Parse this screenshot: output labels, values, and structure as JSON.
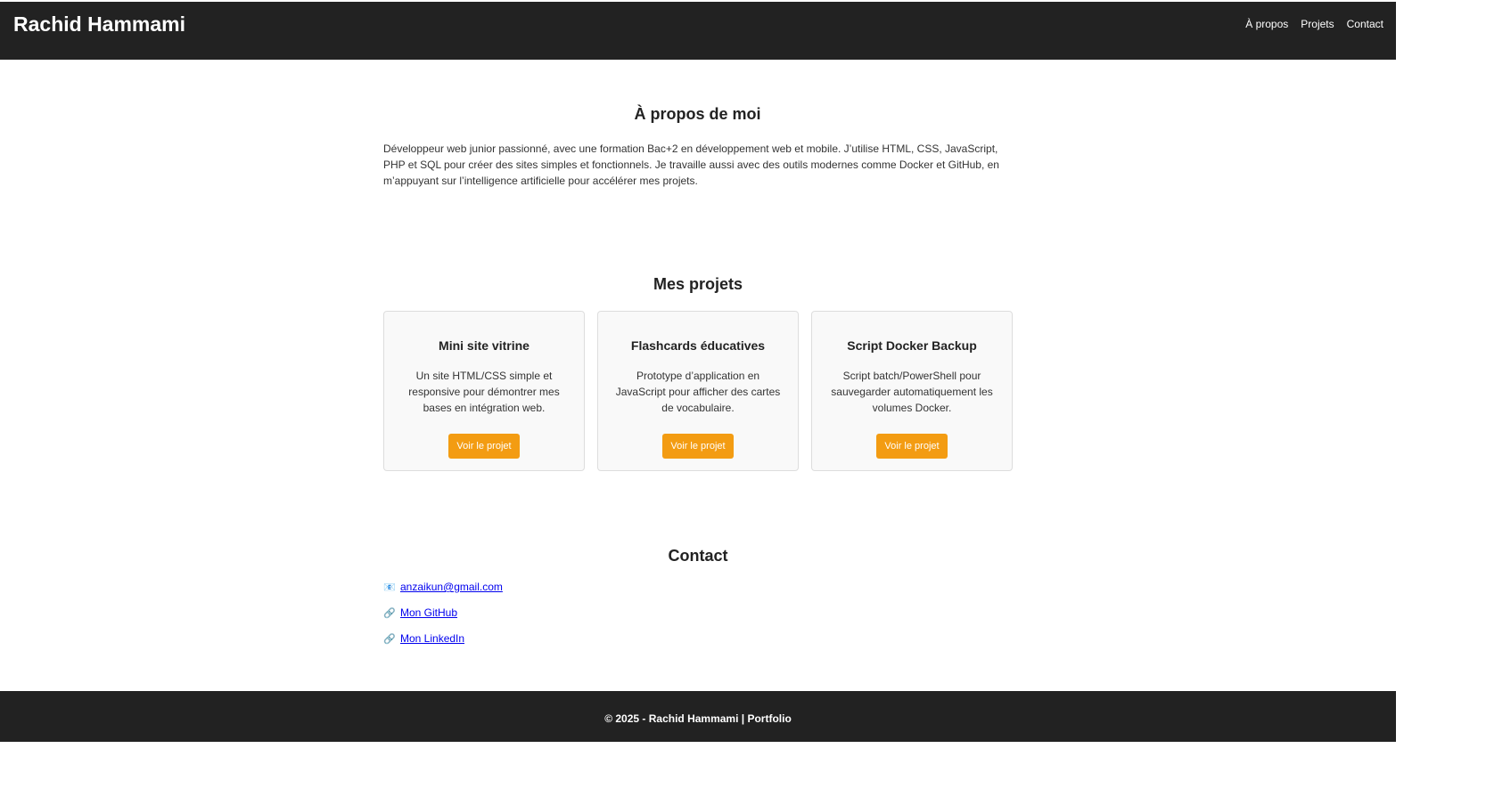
{
  "header": {
    "title": "Rachid Hammami",
    "nav": [
      "À propos",
      "Projets",
      "Contact"
    ]
  },
  "about": {
    "title": "À propos de moi",
    "text": "Développeur web junior passionné, avec une formation Bac+2 en développement web et mobile. J’utilise HTML, CSS, JavaScript, PHP et SQL pour créer des sites simples et fonctionnels. Je travaille aussi avec des outils modernes comme Docker et GitHub, en m’appuyant sur l’intelligence artificielle pour accélérer mes projets."
  },
  "projects": {
    "title": "Mes projets",
    "items": [
      {
        "title": "Mini site vitrine",
        "desc": "Un site HTML/CSS simple et responsive pour démontrer mes bases en intégration web.",
        "button": "Voir le projet"
      },
      {
        "title": "Flashcards éducatives",
        "desc": "Prototype d’application en JavaScript pour afficher des cartes de vocabulaire.",
        "button": "Voir le projet"
      },
      {
        "title": "Script Docker Backup",
        "desc": "Script batch/PowerShell pour sauvegarder automatiquement les volumes Docker.",
        "button": "Voir le projet"
      }
    ]
  },
  "contact": {
    "title": "Contact",
    "items": [
      {
        "icon": "mail-icon",
        "glyph": "📧",
        "label": "anzaikun@gmail.com"
      },
      {
        "icon": "link-icon",
        "glyph": "🔗",
        "label": "Mon GitHub"
      },
      {
        "icon": "link-icon",
        "glyph": "🔗",
        "label": "Mon LinkedIn"
      }
    ]
  },
  "footer": {
    "text": "© 2025 - Rachid Hammami | Portfolio"
  },
  "colors": {
    "header_bg": "#222222",
    "accent": "#f39c12",
    "link": "#0000ee"
  }
}
